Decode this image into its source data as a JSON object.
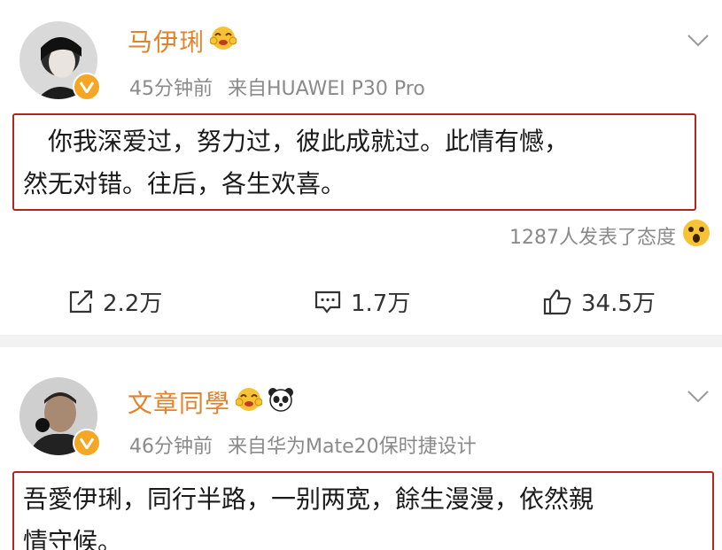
{
  "posts": [
    {
      "username": "马伊琍",
      "time": "45分钟前",
      "source": "来自HUAWEI P30 Pro",
      "content_line1": "　你我深爱过，努力过，彼此成就过。此情有憾，",
      "content_line2": "然无对错。往后，各生欢喜。",
      "reactions_text": "1287人发表了态度",
      "repost_count": "2.2万",
      "comment_count": "1.7万",
      "like_count": "34.5万"
    },
    {
      "username": "文章同學",
      "time": "46分钟前",
      "source": "来自华为Mate20保时捷设计",
      "content_line1": "吾愛伊琍，同行半路，一别两宽，餘生漫漫，依然親",
      "content_line2": "情守候。"
    }
  ],
  "colors": {
    "username": "#e2822b",
    "highlight_border": "#b3261e",
    "meta_text": "#8a8a8a",
    "separator": "#f2f2f2"
  },
  "icons": [
    "chevron-down-icon",
    "verified-badge-icon",
    "emoji-icon",
    "panda-icon",
    "repost-icon",
    "comment-icon",
    "like-icon",
    "surprised-emoji-icon"
  ]
}
